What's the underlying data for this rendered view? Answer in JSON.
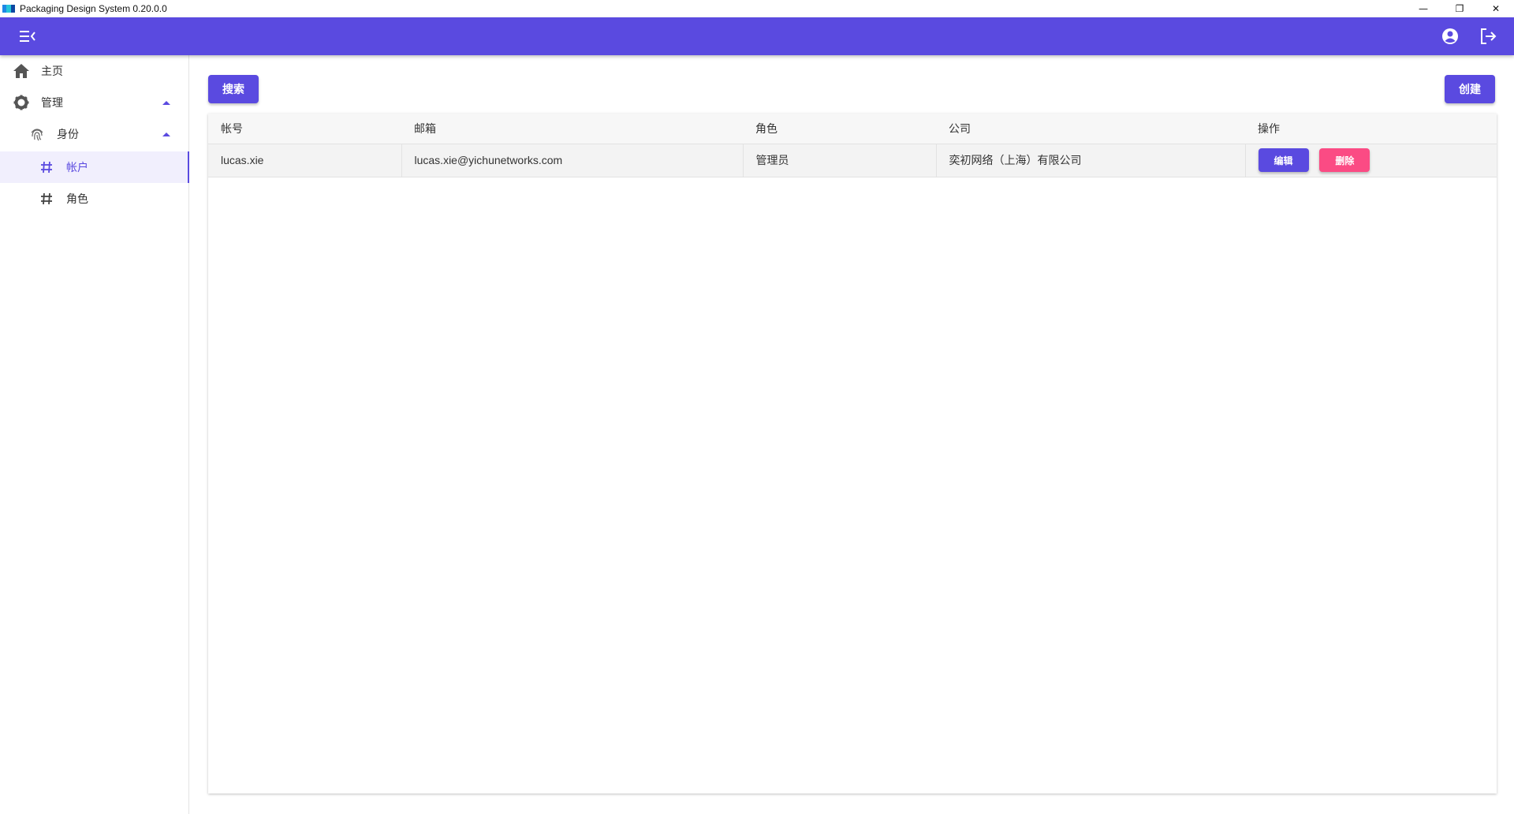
{
  "window": {
    "title": "Packaging Design System 0.20.0.0",
    "controls": {
      "minimize": "—",
      "restore": "❐",
      "close": "✕"
    }
  },
  "colors": {
    "primary": "#5a4ae0",
    "danger": "#fb4b84"
  },
  "appbar": {
    "menu_icon": "menu-collapse-icon",
    "account_icon": "account-circle-icon",
    "logout_icon": "logout-icon"
  },
  "sidebar": {
    "items": [
      {
        "label": "主页",
        "icon": "home-icon"
      },
      {
        "label": "管理",
        "icon": "gear-icon",
        "expanded": true
      },
      {
        "label": "身份",
        "icon": "fingerprint-icon",
        "expanded": true
      },
      {
        "label": "帐户",
        "icon": "hash-icon",
        "active": true
      },
      {
        "label": "角色",
        "icon": "hash-icon"
      }
    ]
  },
  "toolbar": {
    "search_label": "搜索",
    "create_label": "创建"
  },
  "table": {
    "columns": [
      "帐号",
      "邮箱",
      "角色",
      "公司",
      "操作"
    ],
    "rows": [
      {
        "account": "lucas.xie",
        "email": "lucas.xie@yichunetworks.com",
        "role": "管理员",
        "company": "奕初网络（上海）有限公司",
        "edit_label": "编辑",
        "delete_label": "删除"
      }
    ]
  }
}
